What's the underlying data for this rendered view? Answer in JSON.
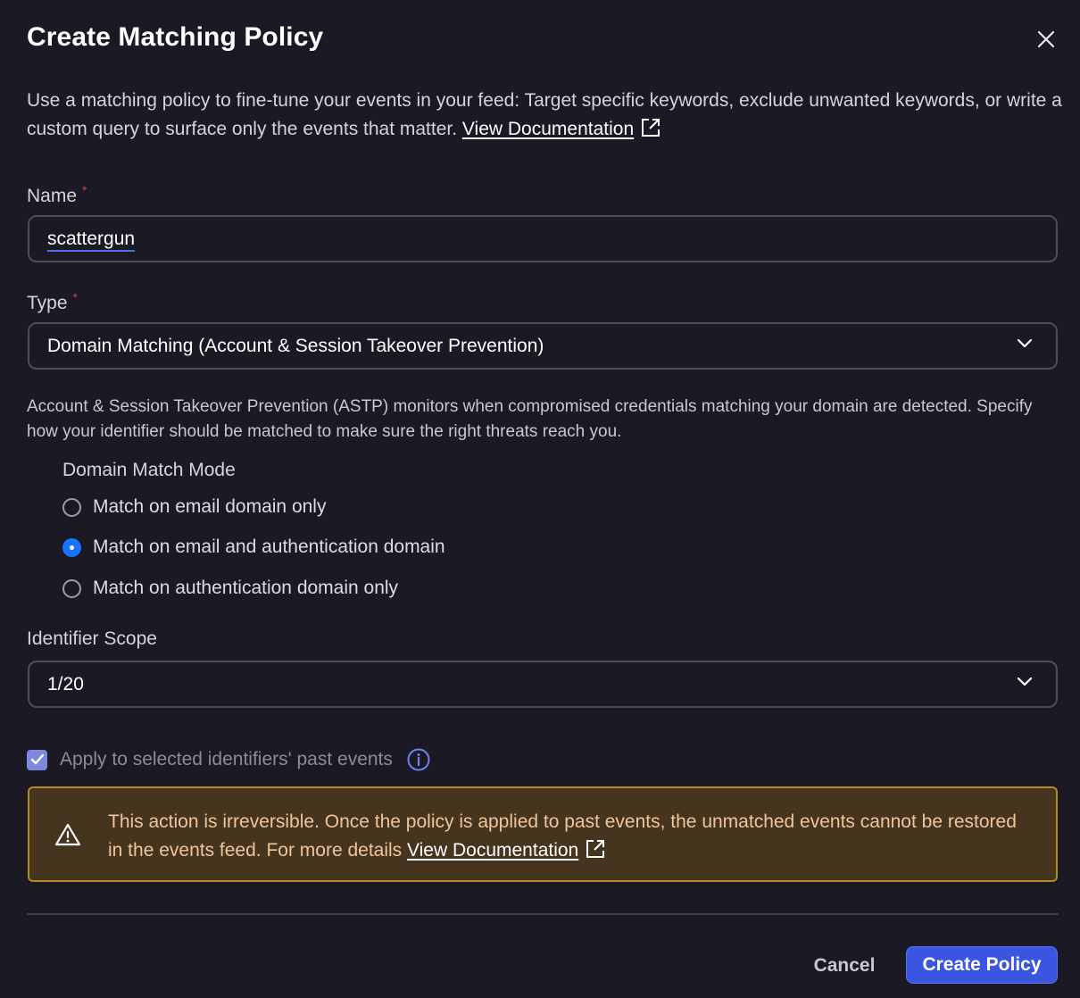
{
  "dialog": {
    "title": "Create Matching Policy",
    "intro_text": "Use a matching policy to fine-tune your events in your feed: Target specific keywords, exclude unwanted keywords, or write a custom query to surface only the events that matter.",
    "doc_link": "View Documentation"
  },
  "name_field": {
    "label": "Name",
    "required_mark": "*",
    "value": "scattergun"
  },
  "type_field": {
    "label": "Type",
    "required_mark": "*",
    "value": "Domain Matching (Account & Session Takeover Prevention)"
  },
  "type_description": "Account & Session Takeover Prevention (ASTP) monitors when compromised credentials matching your domain are detected. Specify how your identifier should be matched to make sure the right threats reach you.",
  "domain_match_mode": {
    "title": "Domain Match Mode",
    "options": [
      {
        "label": "Match on email domain only",
        "selected": false
      },
      {
        "label": "Match on email and authentication domain",
        "selected": true
      },
      {
        "label": "Match on authentication domain only",
        "selected": false
      }
    ]
  },
  "identifier_scope": {
    "label": "Identifier Scope",
    "value": "1/20"
  },
  "past_events": {
    "label": "Apply to selected identifiers' past events",
    "checked": true
  },
  "warning": {
    "text": "This action is irreversible. Once the policy is applied to past events, the unmatched events cannot be restored in the events feed. For more details",
    "link": "View Documentation"
  },
  "footer": {
    "cancel_label": "Cancel",
    "create_label": "Create Policy"
  },
  "colors": {
    "background": "#1b1a24",
    "accent": "#3a55e0",
    "radio_selected": "#1b74ff",
    "warning_border": "#b58b22",
    "warning_bg": "#45351e",
    "required": "#e0393e"
  },
  "icons": {
    "close": "close-icon",
    "external_link": "external-link-icon",
    "dropdown": "chevron-down-icon",
    "info": "info-icon",
    "warning": "warning-triangle-icon",
    "check": "checkmark-icon"
  }
}
